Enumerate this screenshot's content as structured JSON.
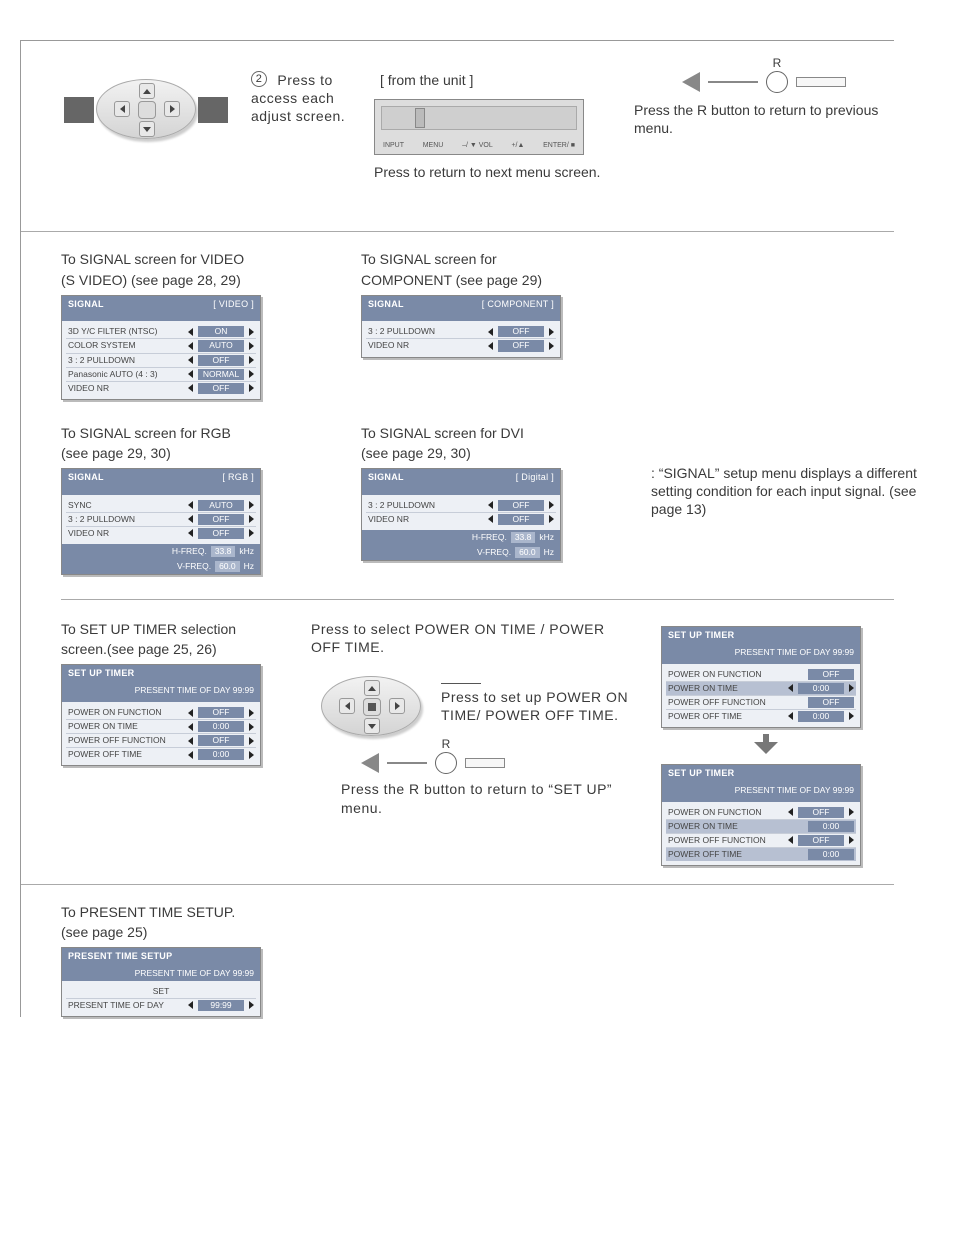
{
  "top": {
    "step_num": "2",
    "step_text": "Press to access each adjust screen.",
    "unit_heading": "[ from the unit ]",
    "unit_caption": "Press to return to next menu screen.",
    "panel_labels": [
      "INPUT",
      "MENU",
      "–/ ▼ VOL",
      "+/▲",
      "ENTER/ ■"
    ],
    "r_label": "R",
    "r_caption": "Press the R button to return to previous menu."
  },
  "signal_video": {
    "title_line1": "To SIGNAL screen for VIDEO",
    "title_line2": "(S VIDEO)  (see page 28, 29)",
    "osd_title": "SIGNAL",
    "osd_tag": "[ VIDEO ]",
    "rows": [
      {
        "lbl": "3D Y/C FILTER (NTSC)",
        "val": "ON"
      },
      {
        "lbl": "COLOR SYSTEM",
        "val": "AUTO"
      },
      {
        "lbl": "3 : 2 PULLDOWN",
        "val": "OFF"
      },
      {
        "lbl": "Panasonic AUTO (4 : 3)",
        "val": "NORMAL"
      },
      {
        "lbl": "VIDEO NR",
        "val": "OFF"
      }
    ]
  },
  "signal_component": {
    "title_line1": "To SIGNAL screen for",
    "title_line2": "COMPONENT (see page 29)",
    "osd_title": "SIGNAL",
    "osd_tag": "[ COMPONENT ]",
    "rows": [
      {
        "lbl": "3 : 2 PULLDOWN",
        "val": "OFF"
      },
      {
        "lbl": "VIDEO NR",
        "val": "OFF"
      }
    ]
  },
  "signal_rgb": {
    "title_line1": "To SIGNAL screen for RGB",
    "title_line2": "(see page 29, 30)",
    "osd_title": "SIGNAL",
    "osd_tag": "[ RGB ]",
    "rows": [
      {
        "lbl": "SYNC",
        "val": "AUTO"
      },
      {
        "lbl": "3 : 2 PULLDOWN",
        "val": "OFF"
      },
      {
        "lbl": "VIDEO NR",
        "val": "OFF"
      }
    ],
    "info": [
      {
        "lbl": "H-FREQ.",
        "val": "33.8",
        "unit": "kHz"
      },
      {
        "lbl": "V-FREQ.",
        "val": "60.0",
        "unit": "Hz"
      }
    ]
  },
  "signal_dvi": {
    "title_line1": "To SIGNAL screen for DVI",
    "title_line2": "(see page 29, 30)",
    "osd_title": "SIGNAL",
    "osd_tag": "[ Digital ]",
    "rows": [
      {
        "lbl": "3 : 2 PULLDOWN",
        "val": "OFF"
      },
      {
        "lbl": "VIDEO NR",
        "val": "OFF"
      }
    ],
    "info": [
      {
        "lbl": "H-FREQ.",
        "val": "33.8",
        "unit": "kHz"
      },
      {
        "lbl": "V-FREQ.",
        "val": "60.0",
        "unit": "Hz"
      }
    ]
  },
  "signal_note": ": “SIGNAL” setup menu displays a different setting condition for each input signal. (see page 13)",
  "timer_sel": {
    "title_line1": "To SET UP TIMER selection",
    "title_line2": "screen.(see page 25, 26)",
    "osd_title": "SET UP TIMER",
    "subtitle": "PRESENT  TIME OF DAY  99:99",
    "rows": [
      {
        "lbl": "POWER ON FUNCTION",
        "val": "OFF"
      },
      {
        "lbl": "POWER ON TIME",
        "val": "0:00"
      },
      {
        "lbl": "POWER OFF FUNCTION",
        "val": "OFF"
      },
      {
        "lbl": "POWER OFF TIME",
        "val": "0:00"
      }
    ]
  },
  "timer_mid": {
    "caption1": "Press to select POWER ON TIME / POWER OFF TIME.",
    "caption2": "Press to set up POWER ON TIME/ POWER OFF TIME.",
    "r_label": "R",
    "r_caption": "Press the R button to return to “SET UP” menu."
  },
  "timer_right": {
    "osd_title": "SET UP TIMER",
    "subtitle": "PRESENT  TIME OF DAY   99:99",
    "rowsA": [
      {
        "lbl": "POWER ON FUNCTION",
        "val": "OFF",
        "sel": false,
        "arrows": false
      },
      {
        "lbl": "POWER ON TIME",
        "val": "0:00",
        "sel": true,
        "arrows": true
      },
      {
        "lbl": "POWER OFF FUNCTION",
        "val": "OFF",
        "sel": false,
        "arrows": false
      },
      {
        "lbl": "POWER OFF TIME",
        "val": "0:00",
        "sel": false,
        "arrows": true
      }
    ],
    "rowsB": [
      {
        "lbl": "POWER ON FUNCTION",
        "val": "OFF",
        "sel": false,
        "arrows": true
      },
      {
        "lbl": "POWER ON TIME",
        "val": "0:00",
        "sel": true,
        "arrows": false
      },
      {
        "lbl": "POWER OFF FUNCTION",
        "val": "OFF",
        "sel": false,
        "arrows": true
      },
      {
        "lbl": "POWER OFF TIME",
        "val": "0:00",
        "sel": true,
        "arrows": false
      }
    ]
  },
  "present_time": {
    "title_line1": "To PRESENT TIME SETUP.",
    "title_line2": "(see page 25)",
    "osd_title": "PRESENT  TIME SETUP",
    "subtitle": "PRESENT  TIME OF DAY   99:99",
    "set_label": "SET",
    "row": {
      "lbl": "PRESENT  TIME OF DAY",
      "val": "99:99"
    }
  }
}
